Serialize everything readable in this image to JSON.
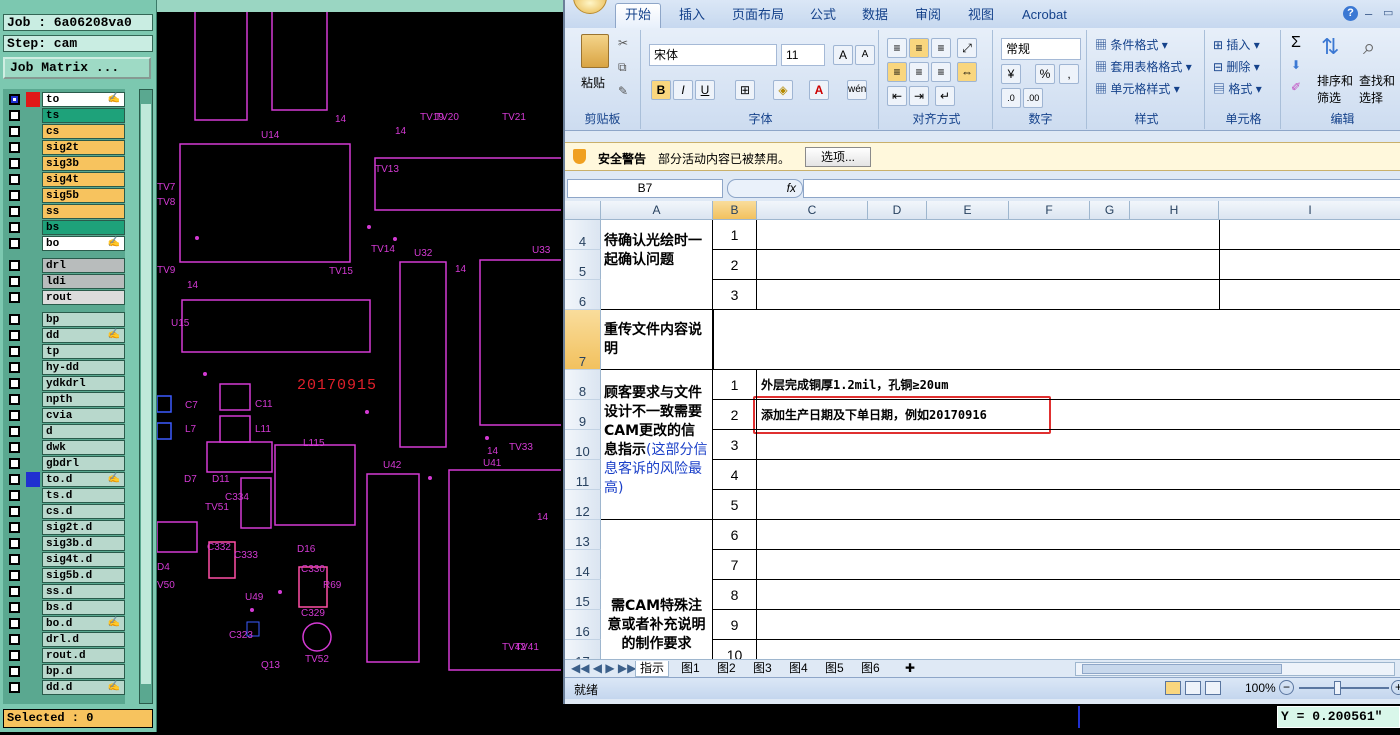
{
  "cam": {
    "job": "Job : 6a06208va0",
    "step": "Step: cam",
    "job_matrix_btn": "Job Matrix ...",
    "selected": "Selected : 0",
    "layers": [
      {
        "name": "to",
        "color": "#ffffff",
        "active": true,
        "icon": "✍"
      },
      {
        "name": "ts",
        "color": "#1ea27a"
      },
      {
        "name": "cs",
        "color": "#f7c35e"
      },
      {
        "name": "sig2t",
        "color": "#f7c35e"
      },
      {
        "name": "sig3b",
        "color": "#f7c35e"
      },
      {
        "name": "sig4t",
        "color": "#f7c35e"
      },
      {
        "name": "sig5b",
        "color": "#f7c35e"
      },
      {
        "name": "ss",
        "color": "#f7c35e"
      },
      {
        "name": "bs",
        "color": "#1ea27a"
      },
      {
        "name": "bo",
        "color": "#ffffff",
        "icon": "✍"
      },
      {
        "name": "drl",
        "color": "#b8bcbc"
      },
      {
        "name": "ldi",
        "color": "#b8bcbc"
      },
      {
        "name": "rout",
        "color": "#dcdcdc"
      },
      {
        "name": "bp",
        "color": "#b8d8cc"
      },
      {
        "name": "dd",
        "color": "#b8d8cc",
        "icon": "✍"
      },
      {
        "name": "tp",
        "color": "#b8d8cc"
      },
      {
        "name": "hy-dd",
        "color": "#b8d8cc"
      },
      {
        "name": "ydkdrl",
        "color": "#b8d8cc"
      },
      {
        "name": "npth",
        "color": "#b8d8cc"
      },
      {
        "name": "cvia",
        "color": "#b8d8cc"
      },
      {
        "name": "d",
        "color": "#b8d8cc"
      },
      {
        "name": "dwk",
        "color": "#b8d8cc"
      },
      {
        "name": "gbdrl",
        "color": "#b8d8cc"
      },
      {
        "name": "to.d",
        "color": "#b8d8cc",
        "icon": "✍",
        "blue": true
      },
      {
        "name": "ts.d",
        "color": "#b8d8cc"
      },
      {
        "name": "cs.d",
        "color": "#b8d8cc"
      },
      {
        "name": "sig2t.d",
        "color": "#b8d8cc"
      },
      {
        "name": "sig3b.d",
        "color": "#b8d8cc"
      },
      {
        "name": "sig4t.d",
        "color": "#b8d8cc"
      },
      {
        "name": "sig5b.d",
        "color": "#b8d8cc"
      },
      {
        "name": "ss.d",
        "color": "#b8d8cc"
      },
      {
        "name": "bs.d",
        "color": "#b8d8cc"
      },
      {
        "name": "bo.d",
        "color": "#b8d8cc",
        "icon": "✍"
      },
      {
        "name": "drl.d",
        "color": "#b8d8cc"
      },
      {
        "name": "rout.d",
        "color": "#b8d8cc"
      },
      {
        "name": "bp.d",
        "color": "#b8d8cc"
      },
      {
        "name": "dd.d",
        "color": "#b8d8cc",
        "icon": "✍"
      }
    ]
  },
  "board": {
    "date_label": "20170915",
    "labels": [
      "U14",
      "TV13",
      "TV7",
      "TV8",
      "TV9",
      "TV14",
      "TV15",
      "U32",
      "U33",
      "U15",
      "C7",
      "C11",
      "L7",
      "L11",
      "L115",
      "U42",
      "U41",
      "TV33",
      "C334",
      "C333",
      "C332",
      "D11",
      "D7",
      "D16",
      "C330",
      "R69",
      "C329",
      "C323",
      "TV52",
      "TV42",
      "TV41",
      "TV19",
      "TV20",
      "TV21",
      "Q13",
      "TV51",
      "U49",
      "V50",
      "D4",
      "14",
      "14",
      "14",
      "14",
      "14",
      "14"
    ]
  },
  "excel": {
    "ribbon_tabs": [
      "开始",
      "插入",
      "页面布局",
      "公式",
      "数据",
      "审阅",
      "视图",
      "Acrobat"
    ],
    "clipboard": {
      "paste": "粘贴",
      "label": "剪贴板"
    },
    "font": {
      "name": "宋体",
      "size": "11",
      "label": "字体"
    },
    "align": {
      "label": "对齐方式"
    },
    "number": {
      "format": "常规",
      "label": "数字"
    },
    "styles": {
      "cond": "条件格式",
      "table": "套用表格格式",
      "cell": "单元格样式",
      "label": "样式"
    },
    "cells": {
      "insert": "插入",
      "delete": "删除",
      "format": "格式",
      "label": "单元格"
    },
    "edit": {
      "sort": "排序和",
      "filter": "筛选",
      "find": "查找和",
      "select": "选择",
      "label": "编辑"
    },
    "security": {
      "title": "安全警告",
      "msg": "部分活动内容已被禁用。",
      "options": "选项..."
    },
    "name_box": "B7",
    "fx": "fx",
    "columns": [
      "A",
      "B",
      "C",
      "D",
      "E",
      "F",
      "G",
      "H",
      "I"
    ],
    "rows": {
      "r4": "4",
      "r5": "5",
      "r6": "6",
      "r7": "7",
      "r8": "8",
      "r9": "9",
      "r10": "10",
      "r11": "11",
      "r12": "12",
      "r13": "13",
      "r14": "14",
      "r15": "15",
      "r16": "16",
      "r17": "17"
    },
    "cellA": {
      "confirm": "待确认光绘时一起确认问题",
      "reupload": "重传文件内容说明",
      "cust_main": "顾客要求与文件设计不一致需要CAM更改的信息指示",
      "cust_note": "(这部分信息客诉的风险最高)",
      "special": "需CAM特殊注意或者补充说明的制作要求"
    },
    "numsB": [
      "1",
      "2",
      "3",
      "1",
      "2",
      "3",
      "4",
      "5",
      "6",
      "7",
      "8",
      "9",
      "10"
    ],
    "req": [
      "外层完成铜厚1.2mil，孔铜≥20um",
      "添加生产日期及下单日期，例如20170916"
    ],
    "sheets": [
      "指示",
      "图1",
      "图2",
      "图3",
      "图4",
      "图5",
      "图6"
    ],
    "status": "就绪",
    "zoom": "100%"
  },
  "coord": "Y = 0.200561\""
}
